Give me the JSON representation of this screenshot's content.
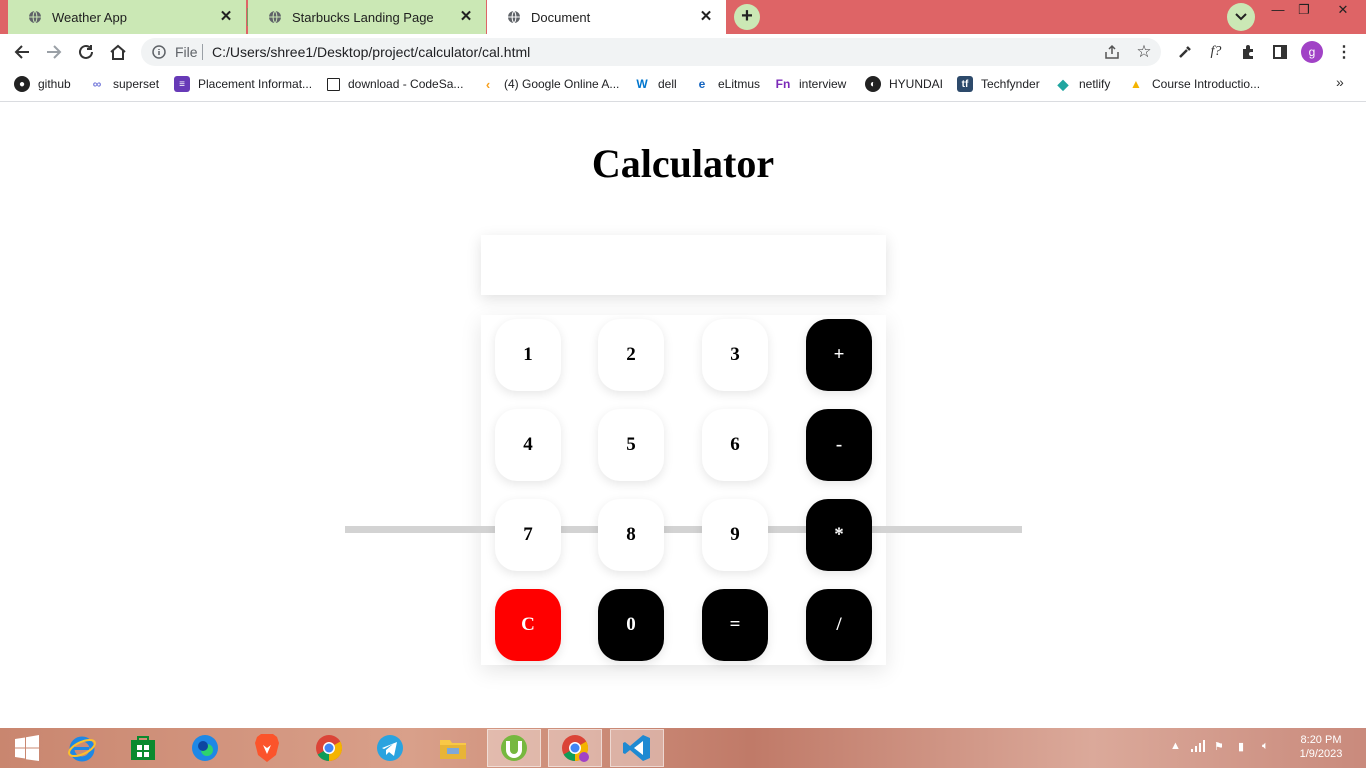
{
  "browser": {
    "tabs": [
      {
        "label": "Weather App"
      },
      {
        "label": "Starbucks Landing Page"
      },
      {
        "label": "Document"
      }
    ],
    "address": {
      "scheme_label": "File",
      "url": "C:/Users/shree1/Desktop/project/calculator/cal.html"
    },
    "profile_initial": "g"
  },
  "bookmarks": [
    {
      "label": "github",
      "icon": "github-icon"
    },
    {
      "label": "superset",
      "icon": "superset-icon"
    },
    {
      "label": "Placement Informat...",
      "icon": "forms-icon"
    },
    {
      "label": "download - CodeSa...",
      "icon": "page-icon"
    },
    {
      "label": "(4) Google Online A...",
      "icon": "leetcode-icon"
    },
    {
      "label": "dell",
      "icon": "dell-icon"
    },
    {
      "label": "eLitmus",
      "icon": "elitmus-icon"
    },
    {
      "label": "interview",
      "icon": "fn-icon"
    },
    {
      "label": "HYUNDAI",
      "icon": "globe-icon"
    },
    {
      "label": "Techfynder",
      "icon": "tf-icon"
    },
    {
      "label": "netlify",
      "icon": "netlify-icon"
    },
    {
      "label": "Course Introductio...",
      "icon": "drive-icon"
    }
  ],
  "page": {
    "title": "Calculator",
    "display_value": "",
    "keys": [
      {
        "label": "1",
        "kind": "num"
      },
      {
        "label": "2",
        "kind": "num"
      },
      {
        "label": "3",
        "kind": "num"
      },
      {
        "label": "+",
        "kind": "op"
      },
      {
        "label": "4",
        "kind": "num"
      },
      {
        "label": "5",
        "kind": "num"
      },
      {
        "label": "6",
        "kind": "num"
      },
      {
        "label": "-",
        "kind": "op"
      },
      {
        "label": "7",
        "kind": "num"
      },
      {
        "label": "8",
        "kind": "num"
      },
      {
        "label": "9",
        "kind": "num"
      },
      {
        "label": "*",
        "kind": "op"
      },
      {
        "label": "C",
        "kind": "clear"
      },
      {
        "label": "0",
        "kind": "op"
      },
      {
        "label": "=",
        "kind": "op"
      },
      {
        "label": "/",
        "kind": "op"
      }
    ]
  },
  "taskbar": {
    "apps": [
      "windows-start-icon",
      "internet-explorer-icon",
      "store-icon",
      "edge-icon",
      "brave-icon",
      "chrome-icon",
      "telegram-icon",
      "file-explorer-icon",
      "utorrent-icon",
      "chrome-running-icon",
      "vscode-icon"
    ],
    "time": "8:20 PM",
    "date": "1/9/2023"
  },
  "colors": {
    "tabstrip": "#de6466",
    "inactive_tab": "#cbe8b5",
    "clear_key": "#ff0000",
    "operator_key": "#000000",
    "number_key": "#ffffff"
  }
}
